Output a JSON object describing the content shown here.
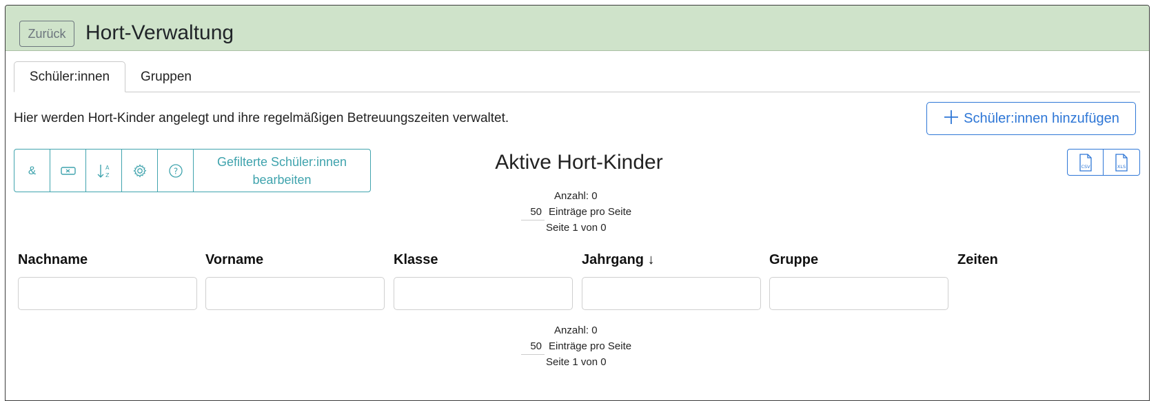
{
  "header": {
    "back_label": "Zurück",
    "title": "Hort-Verwaltung",
    "background": "#cfe3ca"
  },
  "tabs": [
    {
      "label": "Schüler:innen",
      "active": true
    },
    {
      "label": "Gruppen",
      "active": false
    }
  ],
  "description": "Hier werden Hort-Kinder angelegt und ihre regelmäßigen Betreuungszeiten verwaltet.",
  "add_button": {
    "icon": "plus-icon",
    "label": "Schüler:innen hinzufügen",
    "color": "#2d76d6"
  },
  "toolbar": {
    "color": "#3fa3ad",
    "items": [
      {
        "icon": "ampersand-icon",
        "glyph": "&"
      },
      {
        "icon": "clear-badge-icon"
      },
      {
        "icon": "sort-az-icon"
      },
      {
        "icon": "gear-icon"
      },
      {
        "icon": "help-circle-icon"
      }
    ],
    "edit_filtered_label": "Gefilterte Schüler:innen bearbeiten"
  },
  "section_title": "Aktive Hort-Kinder",
  "export": [
    {
      "icon": "csv-file-icon",
      "label": "CSV"
    },
    {
      "icon": "xls-file-icon",
      "label": "XLS"
    }
  ],
  "pager_top": {
    "count": "Anzahl: 0",
    "per_page": "50",
    "per_page_label": "Einträge pro Seite",
    "page_info": "Seite 1 von 0"
  },
  "pager_bottom": {
    "count": "Anzahl: 0",
    "per_page": "50",
    "per_page_label": "Einträge pro Seite",
    "page_info": "Seite 1 von 0"
  },
  "columns": [
    {
      "label": "Nachname",
      "filter_value": ""
    },
    {
      "label": "Vorname",
      "filter_value": ""
    },
    {
      "label": "Klasse",
      "filter_value": ""
    },
    {
      "label": "Jahrgang",
      "sort_indicator": "↓",
      "filter_value": ""
    },
    {
      "label": "Gruppe",
      "filter_value": ""
    },
    {
      "label": "Zeiten"
    }
  ]
}
